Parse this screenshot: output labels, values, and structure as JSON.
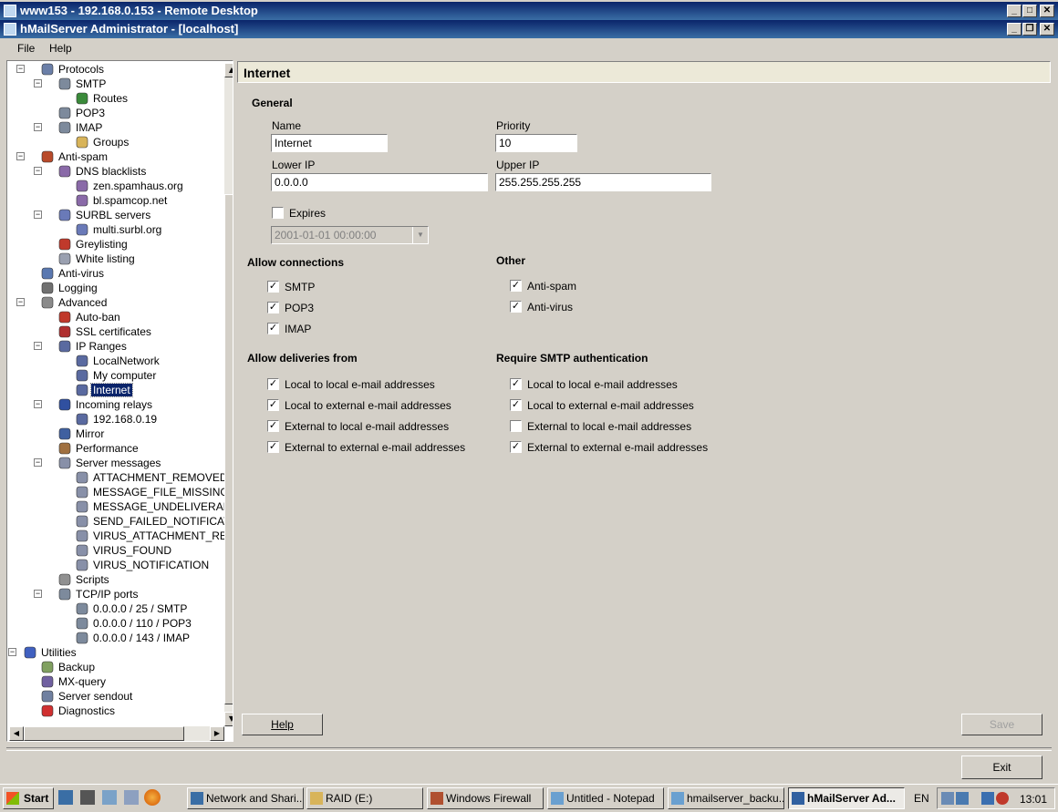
{
  "rdp_window": {
    "title": "www153 - 192.168.0.153 - Remote Desktop"
  },
  "app_window": {
    "title": "hMailServer Administrator - [localhost]"
  },
  "menu": {
    "file": "File",
    "help": "Help"
  },
  "tree": [
    {
      "label": "Protocols",
      "indent": 1,
      "expander": "-",
      "icon": "protocols-icon"
    },
    {
      "label": "SMTP",
      "indent": 2,
      "expander": "-",
      "icon": "protocol-icon"
    },
    {
      "label": "Routes",
      "indent": 3,
      "expander": "",
      "icon": "routes-icon"
    },
    {
      "label": "POP3",
      "indent": 2,
      "expander": "",
      "icon": "protocol-icon"
    },
    {
      "label": "IMAP",
      "indent": 2,
      "expander": "-",
      "icon": "protocol-icon"
    },
    {
      "label": "Groups",
      "indent": 3,
      "expander": "",
      "icon": "folder-icon"
    },
    {
      "label": "Anti-spam",
      "indent": 1,
      "expander": "-",
      "icon": "antispam-icon"
    },
    {
      "label": "DNS blacklists",
      "indent": 2,
      "expander": "-",
      "icon": "blacklist-icon"
    },
    {
      "label": "zen.spamhaus.org",
      "indent": 3,
      "expander": "",
      "icon": "blacklist-icon"
    },
    {
      "label": "bl.spamcop.net",
      "indent": 3,
      "expander": "",
      "icon": "blacklist-icon"
    },
    {
      "label": "SURBL servers",
      "indent": 2,
      "expander": "-",
      "icon": "surbl-icon"
    },
    {
      "label": "multi.surbl.org",
      "indent": 3,
      "expander": "",
      "icon": "surbl-icon"
    },
    {
      "label": "Greylisting",
      "indent": 2,
      "expander": "",
      "icon": "greylisting-icon"
    },
    {
      "label": "White listing",
      "indent": 2,
      "expander": "",
      "icon": "whitelist-icon"
    },
    {
      "label": "Anti-virus",
      "indent": 1,
      "expander": "",
      "icon": "shield-icon"
    },
    {
      "label": "Logging",
      "indent": 1,
      "expander": "",
      "icon": "logging-icon"
    },
    {
      "label": "Advanced",
      "indent": 1,
      "expander": "-",
      "icon": "advanced-icon"
    },
    {
      "label": "Auto-ban",
      "indent": 2,
      "expander": "",
      "icon": "autoban-icon"
    },
    {
      "label": "SSL certificates",
      "indent": 2,
      "expander": "",
      "icon": "certificate-icon"
    },
    {
      "label": "IP Ranges",
      "indent": 2,
      "expander": "-",
      "icon": "ip-range-icon"
    },
    {
      "label": "LocalNetwork",
      "indent": 3,
      "expander": "",
      "icon": "ip-range-icon"
    },
    {
      "label": "My computer",
      "indent": 3,
      "expander": "",
      "icon": "ip-range-icon"
    },
    {
      "label": "Internet",
      "indent": 3,
      "expander": "",
      "icon": "ip-range-icon",
      "selected": true
    },
    {
      "label": "Incoming relays",
      "indent": 2,
      "expander": "-",
      "icon": "relay-icon"
    },
    {
      "label": "192.168.0.19",
      "indent": 3,
      "expander": "",
      "icon": "ip-range-icon"
    },
    {
      "label": "Mirror",
      "indent": 2,
      "expander": "",
      "icon": "mirror-icon"
    },
    {
      "label": "Performance",
      "indent": 2,
      "expander": "",
      "icon": "performance-icon"
    },
    {
      "label": "Server messages",
      "indent": 2,
      "expander": "-",
      "icon": "document-icon"
    },
    {
      "label": "ATTACHMENT_REMOVED",
      "indent": 3,
      "expander": "",
      "icon": "document-icon"
    },
    {
      "label": "MESSAGE_FILE_MISSING",
      "indent": 3,
      "expander": "",
      "icon": "document-icon"
    },
    {
      "label": "MESSAGE_UNDELIVERABLE",
      "indent": 3,
      "expander": "",
      "icon": "document-icon"
    },
    {
      "label": "SEND_FAILED_NOTIFICATION",
      "indent": 3,
      "expander": "",
      "icon": "document-icon"
    },
    {
      "label": "VIRUS_ATTACHMENT_REMOVED",
      "indent": 3,
      "expander": "",
      "icon": "document-icon"
    },
    {
      "label": "VIRUS_FOUND",
      "indent": 3,
      "expander": "",
      "icon": "document-icon"
    },
    {
      "label": "VIRUS_NOTIFICATION",
      "indent": 3,
      "expander": "",
      "icon": "document-icon"
    },
    {
      "label": "Scripts",
      "indent": 2,
      "expander": "",
      "icon": "script-icon"
    },
    {
      "label": "TCP/IP ports",
      "indent": 2,
      "expander": "-",
      "icon": "protocol-icon"
    },
    {
      "label": "0.0.0.0 / 25 / SMTP",
      "indent": 3,
      "expander": "",
      "icon": "protocol-icon"
    },
    {
      "label": "0.0.0.0 / 110 / POP3",
      "indent": 3,
      "expander": "",
      "icon": "protocol-icon"
    },
    {
      "label": "0.0.0.0 / 143 / IMAP",
      "indent": 3,
      "expander": "",
      "icon": "protocol-icon"
    },
    {
      "label": "Utilities",
      "indent": 0,
      "expander": "-",
      "icon": "star-icon"
    },
    {
      "label": "Backup",
      "indent": 1,
      "expander": "",
      "icon": "backup-icon"
    },
    {
      "label": "MX-query",
      "indent": 1,
      "expander": "",
      "icon": "mx-query-icon"
    },
    {
      "label": "Server sendout",
      "indent": 1,
      "expander": "",
      "icon": "sendout-icon"
    },
    {
      "label": "Diagnostics",
      "indent": 1,
      "expander": "",
      "icon": "heart-icon"
    }
  ],
  "panel": {
    "header": "Internet",
    "general": "General",
    "name_label": "Name",
    "name_value": "Internet",
    "priority_label": "Priority",
    "priority_value": "10",
    "lower_ip_label": "Lower IP",
    "lower_ip_value": "0.0.0.0",
    "upper_ip_label": "Upper IP",
    "upper_ip_value": "255.255.255.255",
    "expires_label": "Expires",
    "expires_checked": false,
    "expires_date": "2001-01-01 00:00:00",
    "allow_connections": "Allow connections",
    "conn": [
      {
        "label": "SMTP",
        "checked": true
      },
      {
        "label": "POP3",
        "checked": true
      },
      {
        "label": "IMAP",
        "checked": true
      }
    ],
    "other": "Other",
    "other_items": [
      {
        "label": "Anti-spam",
        "checked": true
      },
      {
        "label": "Anti-virus",
        "checked": true
      }
    ],
    "allow_deliveries": "Allow deliveries from",
    "deliveries": [
      {
        "label": "Local to local e-mail addresses",
        "checked": true
      },
      {
        "label": "Local to external e-mail addresses",
        "checked": true
      },
      {
        "label": "External to local e-mail addresses",
        "checked": true
      },
      {
        "label": "External to external e-mail addresses",
        "checked": true
      }
    ],
    "require_auth": "Require SMTP authentication",
    "auth": [
      {
        "label": "Local to local e-mail addresses",
        "checked": true
      },
      {
        "label": "Local to external e-mail addresses",
        "checked": true
      },
      {
        "label": "External to local e-mail addresses",
        "checked": false
      },
      {
        "label": "External to external e-mail addresses",
        "checked": true
      }
    ],
    "help_button": "Help",
    "save_button": "Save"
  },
  "exit_button": "Exit",
  "taskbar": {
    "start": "Start",
    "tasks": [
      {
        "label": "Network and Shari...",
        "icon": "network-icon"
      },
      {
        "label": "RAID (E:)",
        "icon": "folder-icon"
      },
      {
        "label": "Windows Firewall",
        "icon": "firewall-icon"
      },
      {
        "label": "Untitled - Notepad",
        "icon": "notepad-icon"
      },
      {
        "label": "hmailserver_backu...",
        "icon": "notepad-icon"
      },
      {
        "label": "hMailServer Ad...",
        "icon": "hmailserver-icon",
        "active": true
      }
    ],
    "lang": "EN",
    "clock": "13:01"
  }
}
